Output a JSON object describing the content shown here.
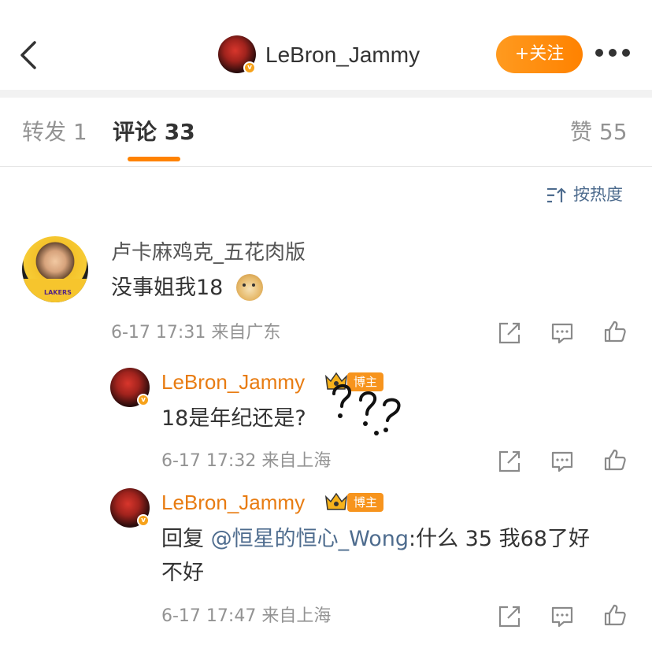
{
  "header": {
    "username": "LeBron_Jammy",
    "follow_label": "+关注",
    "verified_icon": "verified-badge-icon"
  },
  "tabs": {
    "repost": "转发 1",
    "comments": "评论 33",
    "likes": "赞 55"
  },
  "sort": {
    "label": "按热度",
    "icon": "sort-icon"
  },
  "comments": [
    {
      "username": "卢卡麻鸡克_五花肉版",
      "text": "没事姐我18",
      "emoji": "doge-emoji",
      "meta": "6-17 17:31 来自广东"
    },
    {
      "username": "LeBron_Jammy",
      "author_tag": "博主",
      "text": "18是年纪还是?",
      "meta": "6-17 17:32 来自上海"
    },
    {
      "username": "LeBron_Jammy",
      "author_tag": "博主",
      "reply_prefix": "回复 ",
      "mention": "@恒星的恒心_Wong",
      "text_line1": ":什么 35 我68了好",
      "text_line2": "不好",
      "meta": "6-17 17:47 来自上海"
    }
  ],
  "colors": {
    "accent": "#ff8200",
    "link": "#4e6c8e",
    "author_name": "#e87c12"
  }
}
